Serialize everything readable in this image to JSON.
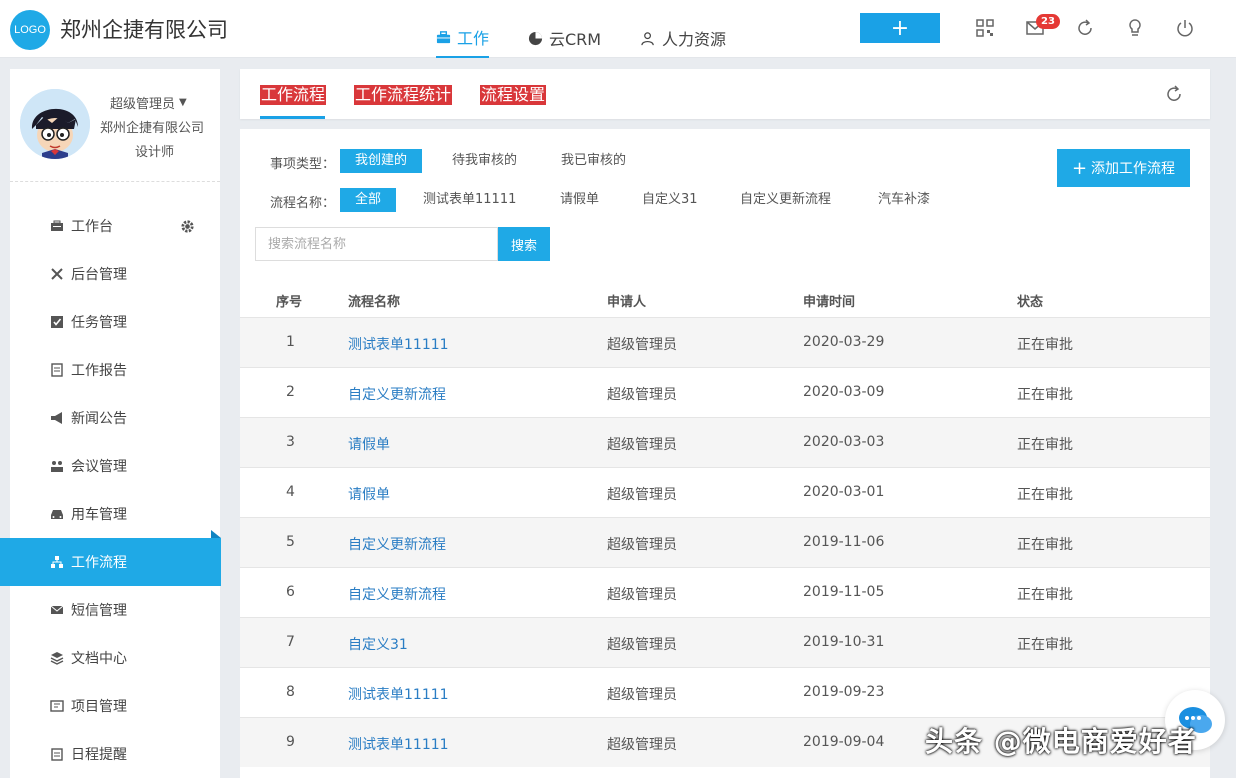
{
  "header": {
    "logo_text": "LOGO",
    "company": "郑州企捷有限公司",
    "nav": [
      {
        "label": "工作",
        "icon": "briefcase-icon"
      },
      {
        "label": "云CRM",
        "icon": "pie-chart-icon"
      },
      {
        "label": "人力资源",
        "icon": "people-icon"
      }
    ],
    "plus_label": "+",
    "mail_badge": "23"
  },
  "sidebar": {
    "user_name": "超级管理员",
    "user_company": "郑州企捷有限公司",
    "user_role": "设计师",
    "items": [
      {
        "label": "工作台",
        "icon": "workbench-icon"
      },
      {
        "label": "后台管理",
        "icon": "tools-icon"
      },
      {
        "label": "任务管理",
        "icon": "checkbox-icon"
      },
      {
        "label": "工作报告",
        "icon": "report-icon"
      },
      {
        "label": "新闻公告",
        "icon": "megaphone-icon"
      },
      {
        "label": "会议管理",
        "icon": "meeting-icon"
      },
      {
        "label": "用车管理",
        "icon": "car-icon"
      },
      {
        "label": "工作流程",
        "icon": "flow-icon"
      },
      {
        "label": "短信管理",
        "icon": "envelope-icon"
      },
      {
        "label": "文档中心",
        "icon": "layers-icon"
      },
      {
        "label": "项目管理",
        "icon": "project-icon"
      },
      {
        "label": "日程提醒",
        "icon": "schedule-icon"
      }
    ],
    "active_index": 7
  },
  "tabs": [
    "工作流程",
    "工作流程统计",
    "流程设置"
  ],
  "filters": {
    "type_label": "事项类型：",
    "type_options": [
      "我创建的",
      "待我审核的",
      "我已审核的"
    ],
    "name_label": "流程名称：",
    "name_options": [
      "全部",
      "测试表单11111",
      "请假单",
      "自定义31",
      "自定义更新流程",
      "汽车补漆"
    ]
  },
  "add_button": "添加工作流程",
  "search": {
    "placeholder": "搜索流程名称",
    "button": "搜索"
  },
  "table": {
    "headers": [
      "序号",
      "流程名称",
      "申请人",
      "申请时间",
      "状态"
    ],
    "rows": [
      [
        "1",
        "测试表单11111",
        "超级管理员",
        "2020-03-29",
        "正在审批"
      ],
      [
        "2",
        "自定义更新流程",
        "超级管理员",
        "2020-03-09",
        "正在审批"
      ],
      [
        "3",
        "请假单",
        "超级管理员",
        "2020-03-03",
        "正在审批"
      ],
      [
        "4",
        "请假单",
        "超级管理员",
        "2020-03-01",
        "正在审批"
      ],
      [
        "5",
        "自定义更新流程",
        "超级管理员",
        "2019-11-06",
        "正在审批"
      ],
      [
        "6",
        "自定义更新流程",
        "超级管理员",
        "2019-11-05",
        "正在审批"
      ],
      [
        "7",
        "自定义31",
        "超级管理员",
        "2019-10-31",
        "正在审批"
      ],
      [
        "8",
        "测试表单11111",
        "超级管理员",
        "2019-09-23",
        ""
      ],
      [
        "9",
        "测试表单11111",
        "超级管理员",
        "2019-09-04",
        ""
      ]
    ]
  },
  "watermark": "头条 @微电商爱好者"
}
